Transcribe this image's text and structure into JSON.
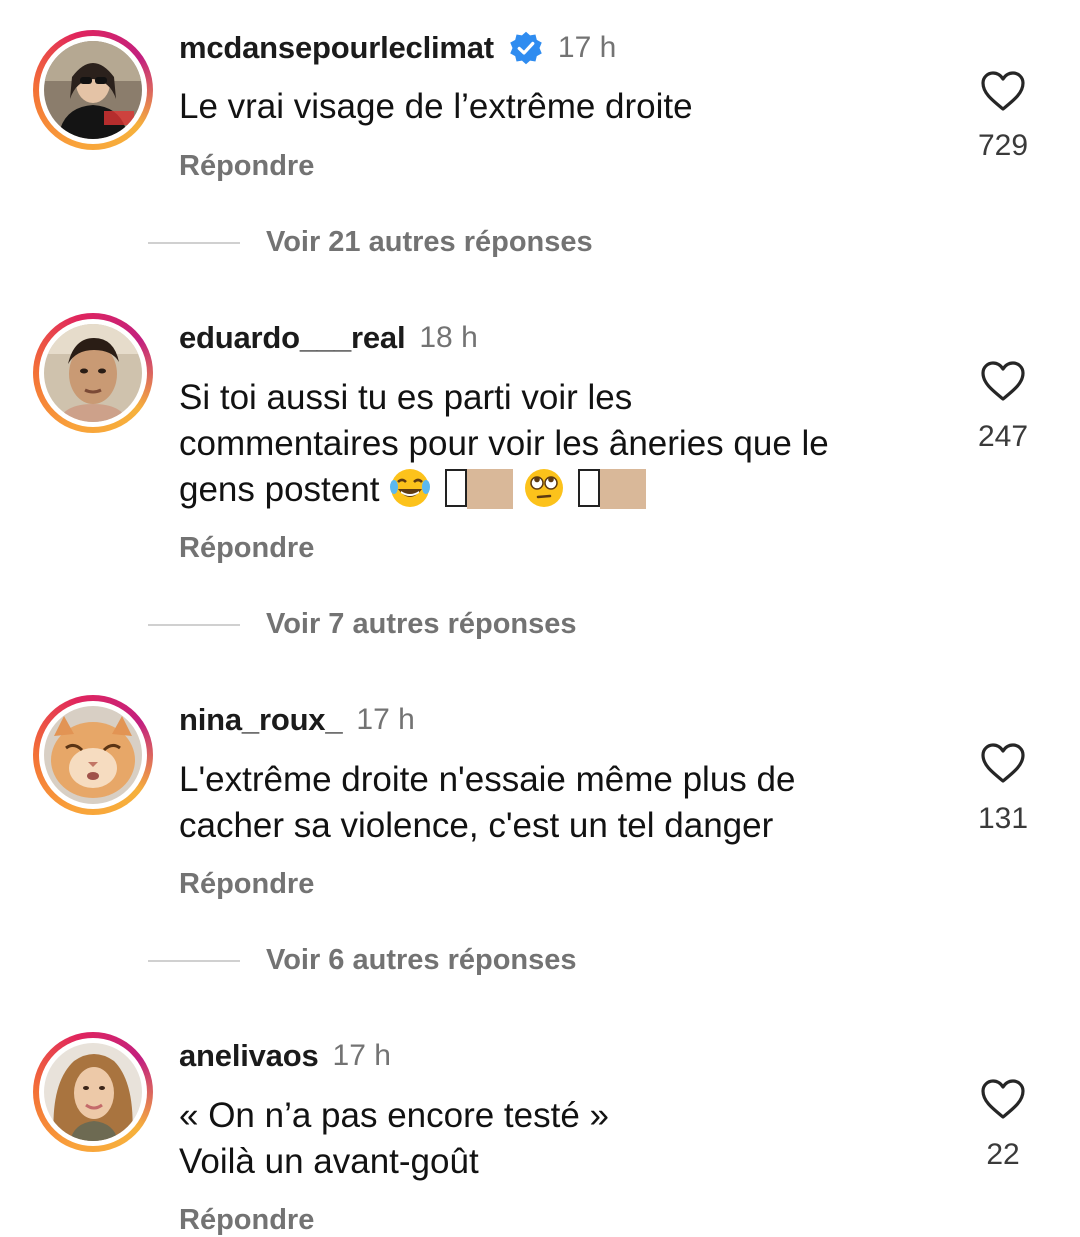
{
  "comments": [
    {
      "username": "mcdansepourleclimat",
      "verified": true,
      "time": "17 h",
      "text": "Le vrai visage de l’extrême droite",
      "reply_label": "Répondre",
      "likes": "729",
      "more_replies": "Voir 21 autres réponses"
    },
    {
      "username": "eduardo___real",
      "verified": false,
      "time": "18 h",
      "text_line1": "Si toi aussi tu es parti voir les",
      "text_line2": "commentaires pour voir les âneries que le",
      "text_line3": "gens postent",
      "reply_label": "Répondre",
      "likes": "247",
      "more_replies": "Voir 7 autres réponses"
    },
    {
      "username": "nina_roux_",
      "verified": false,
      "time": "17 h",
      "text_line1": "L'extrême droite n'essaie même plus de",
      "text_line2": "cacher sa violence, c'est un tel danger",
      "reply_label": "Répondre",
      "likes": "131",
      "more_replies": "Voir 6 autres réponses"
    },
    {
      "username": "anelivaos",
      "verified": false,
      "time": "17 h",
      "text_line1": "« On n’a pas encore testé »",
      "text_line2": "Voilà un avant-goût",
      "reply_label": "Répondre",
      "likes": "22"
    }
  ],
  "icons": {
    "like": "heart-outline-icon",
    "verified": "verified-badge-icon",
    "emoji_laugh": "face-with-tears-of-joy",
    "emoji_eyeroll": "face-with-rolling-eyes"
  },
  "colors": {
    "verified_blue": "#2f8cf0",
    "muted_text": "#737373",
    "ring_start": "#f9a23a",
    "ring_end": "#c2207f"
  }
}
